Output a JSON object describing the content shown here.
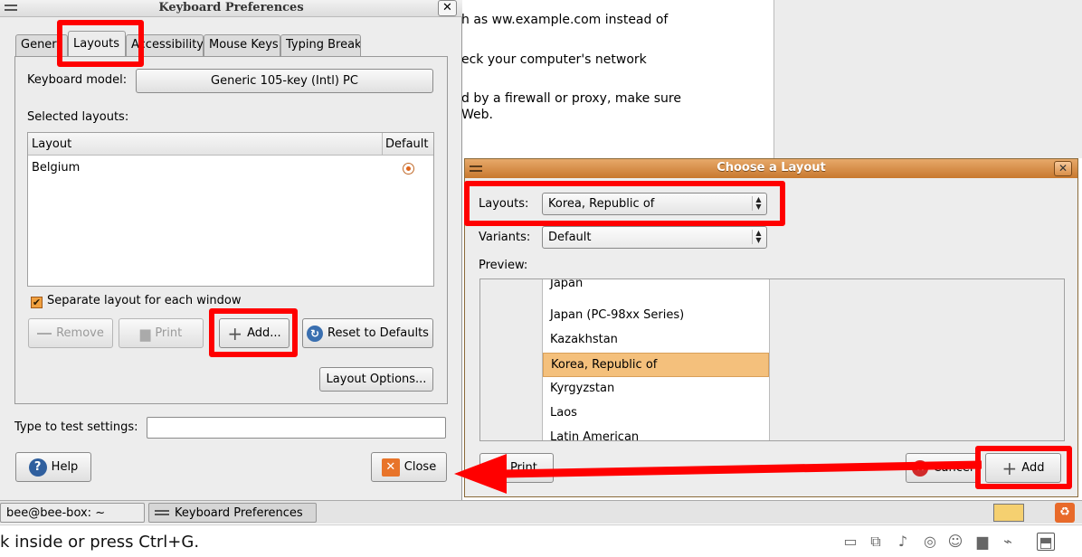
{
  "background_page": {
    "lines": [
      "h as ww.example.com instead of",
      "eck your computer's network",
      "d by a firewall or proxy, make sure",
      "Web."
    ]
  },
  "keyboard_prefs": {
    "title": "Keyboard Preferences",
    "tabs": [
      "Gener",
      "Layouts",
      "Accessibility",
      "Mouse Keys",
      "Typing Break"
    ],
    "active_tab": "Layouts",
    "keyboard_model_label": "Keyboard model:",
    "keyboard_model_value": "Generic 105-key (Intl) PC",
    "selected_layouts_label": "Selected layouts:",
    "columns": [
      "Layout",
      "Default"
    ],
    "rows": [
      {
        "layout": "Belgium",
        "default": true
      }
    ],
    "separate_layout_label": "Separate layout for each window",
    "separate_layout_checked": true,
    "buttons": {
      "remove": "Remove",
      "print": "Print",
      "add": "Add...",
      "reset": "Reset to Defaults",
      "layout_options": "Layout Options...",
      "help": "Help",
      "close": "Close"
    },
    "test_label": "Type to test settings:",
    "test_value": ""
  },
  "choose_layout": {
    "title": "Choose a Layout",
    "layouts_label": "Layouts:",
    "layouts_value": "Korea, Republic of",
    "variants_label": "Variants:",
    "variants_value": "Default",
    "preview_label": "Preview:",
    "preview_items": [
      "Japan",
      "Japan (PC-98xx Series)",
      "Kazakhstan",
      "Korea, Republic of",
      "Kyrgyzstan",
      "Laos",
      "Latin American"
    ],
    "selected_item": "Korea, Republic of",
    "buttons": {
      "print": "Print",
      "cancel": "Cancel",
      "add": "Add"
    }
  },
  "taskbar": {
    "items": [
      "bee@bee-box: ~",
      "Keyboard Preferences"
    ]
  },
  "statusbar": {
    "text": "k inside or press Ctrl+G."
  },
  "colors": {
    "annotation": "#ff0000",
    "title_accent": "#c8782e",
    "selection": "#f4c07c"
  }
}
